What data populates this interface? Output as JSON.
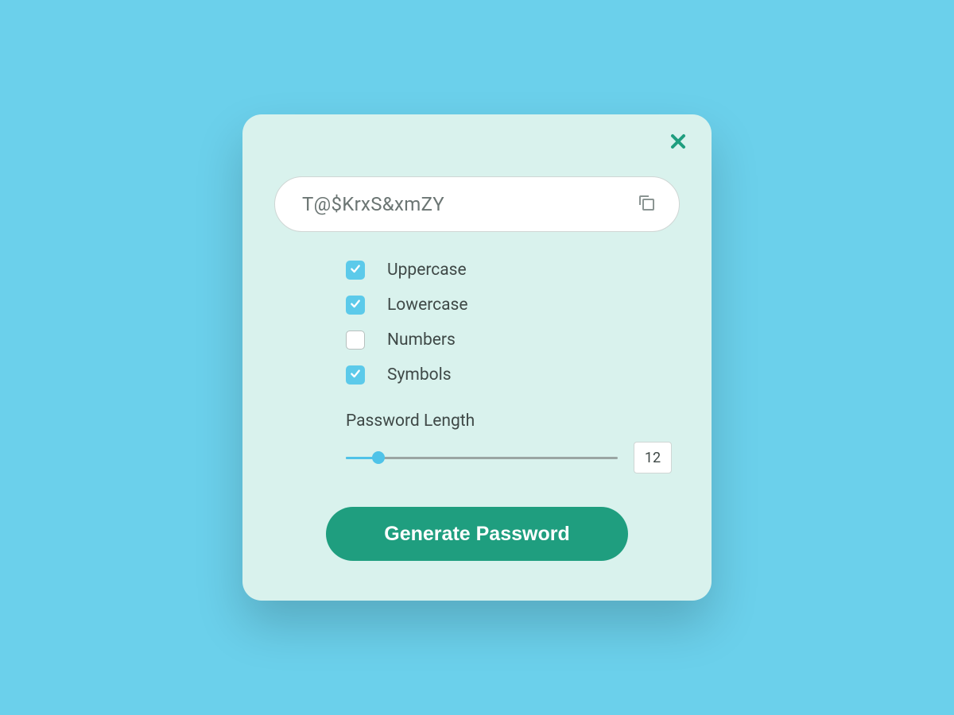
{
  "password": "T@$KrxS&xmZY",
  "options": {
    "uppercase": {
      "label": "Uppercase",
      "checked": true
    },
    "lowercase": {
      "label": "Lowercase",
      "checked": true
    },
    "numbers": {
      "label": "Numbers",
      "checked": false
    },
    "symbols": {
      "label": "Symbols",
      "checked": true
    }
  },
  "length": {
    "label": "Password Length",
    "value": "12"
  },
  "generate_label": "Generate Password"
}
